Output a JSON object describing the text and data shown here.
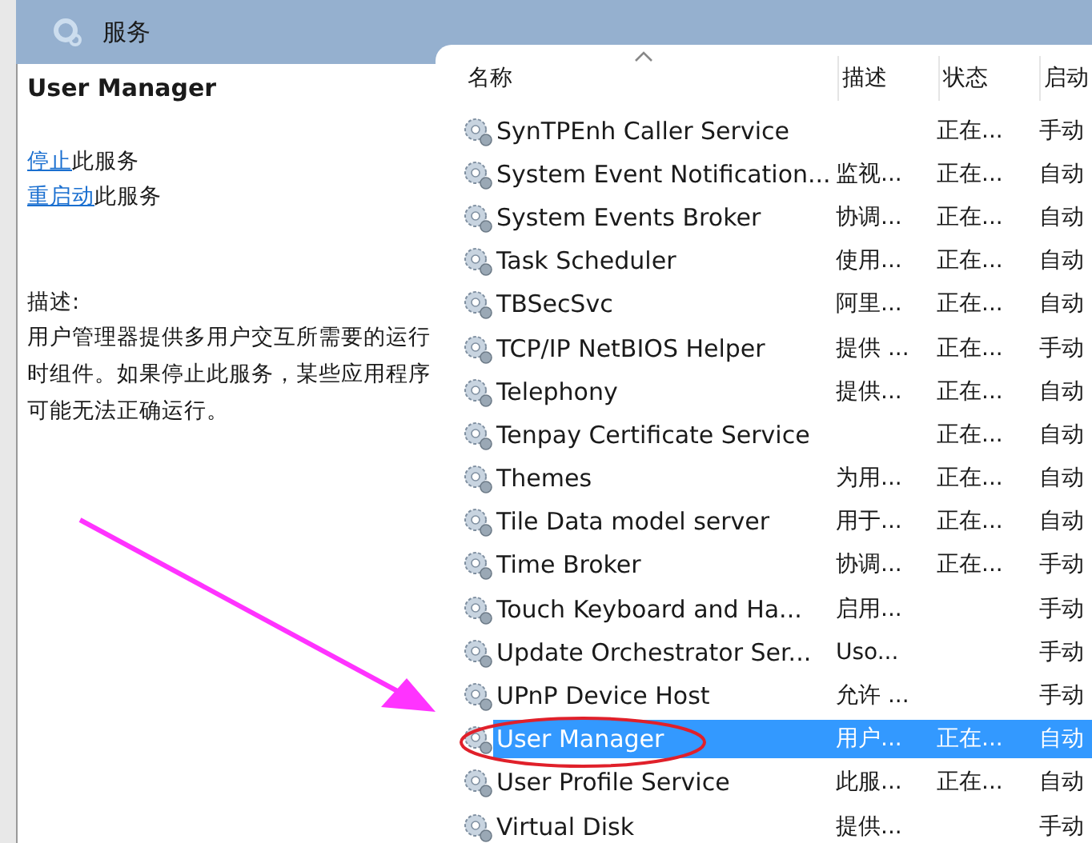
{
  "window": {
    "title": "服务"
  },
  "detail": {
    "service_name": "User Manager",
    "actions": [
      {
        "link": "停止",
        "rest": "此服务"
      },
      {
        "link": "重启动",
        "rest": "此服务"
      }
    ],
    "description_label": "描述:",
    "description": "用户管理器提供多用户交互所需要的运行时组件。如果停止此服务，某些应用程序可能无法正确运行。"
  },
  "table": {
    "columns": [
      "名称",
      "描述",
      "状态",
      "启动"
    ],
    "rows": [
      {
        "name": "SynTPEnh Caller Service",
        "description": "",
        "status": "正在...",
        "startup": "手动",
        "selected": false
      },
      {
        "name": "System Event Notification...",
        "description": "监视...",
        "status": "正在...",
        "startup": "自动",
        "selected": false
      },
      {
        "name": "System Events Broker",
        "description": "协调...",
        "status": "正在...",
        "startup": "自动",
        "selected": false
      },
      {
        "name": "Task Scheduler",
        "description": "使用...",
        "status": "正在...",
        "startup": "自动",
        "selected": false
      },
      {
        "name": "TBSecSvc",
        "description": "阿里...",
        "status": "正在...",
        "startup": "自动",
        "selected": false
      },
      {
        "name": "TCP/IP NetBIOS Helper",
        "description": "提供 ...",
        "status": "正在...",
        "startup": "手动",
        "selected": false
      },
      {
        "name": "Telephony",
        "description": "提供...",
        "status": "正在...",
        "startup": "自动",
        "selected": false
      },
      {
        "name": "Tenpay Certificate Service",
        "description": "",
        "status": "正在...",
        "startup": "自动",
        "selected": false
      },
      {
        "name": "Themes",
        "description": "为用...",
        "status": "正在...",
        "startup": "自动",
        "selected": false
      },
      {
        "name": "Tile Data model server",
        "description": "用于...",
        "status": "正在...",
        "startup": "自动",
        "selected": false
      },
      {
        "name": "Time Broker",
        "description": "协调...",
        "status": "正在...",
        "startup": "手动",
        "selected": false
      },
      {
        "name": "Touch Keyboard and Ha...",
        "description": "启用...",
        "status": "",
        "startup": "手动",
        "selected": false
      },
      {
        "name": "Update Orchestrator Ser...",
        "description": "Uso...",
        "status": "",
        "startup": "手动",
        "selected": false
      },
      {
        "name": "UPnP Device Host",
        "description": "允许 ...",
        "status": "",
        "startup": "手动",
        "selected": false
      },
      {
        "name": "User Manager",
        "description": "用户...",
        "status": "正在...",
        "startup": "自动",
        "selected": true
      },
      {
        "name": "User Profile Service",
        "description": "此服...",
        "status": "正在...",
        "startup": "自动",
        "selected": false
      },
      {
        "name": "Virtual Disk",
        "description": "提供...",
        "status": "",
        "startup": "手动",
        "selected": false
      }
    ]
  }
}
